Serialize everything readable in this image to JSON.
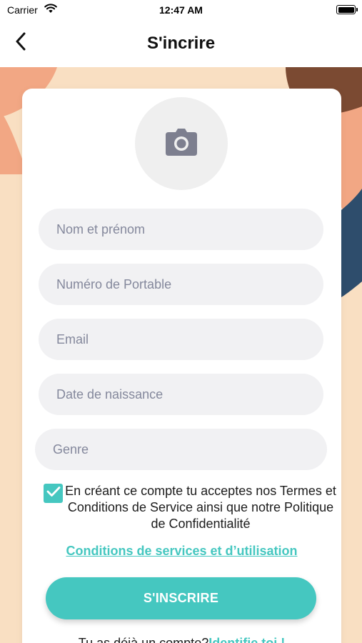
{
  "status_bar": {
    "carrier": "Carrier",
    "time": "12:47 AM",
    "wifi_icon": "wifi-icon",
    "battery_icon": "battery-icon"
  },
  "header": {
    "title": "S'incrire",
    "back_icon": "chevron-left-icon"
  },
  "avatar": {
    "icon": "camera-icon"
  },
  "form": {
    "full_name": {
      "placeholder": "Nom et prénom",
      "value": ""
    },
    "phone": {
      "placeholder": "Numéro de Portable",
      "value": ""
    },
    "email": {
      "placeholder": "Email",
      "value": ""
    },
    "birth_date": {
      "placeholder": "Date de naissance",
      "value": ""
    },
    "gender": {
      "placeholder": "Genre",
      "value": ""
    }
  },
  "consent": {
    "checked": true,
    "text": "En créant ce compte tu acceptes nos Termes et Conditions de Service ainsi que notre Politique de Confidentialité",
    "terms_link": "Conditions de services et d’utilisation"
  },
  "submit_label": "S'INSCRIRE",
  "login": {
    "prompt": "Tu as déjà un compte?",
    "link": "Identifie toi !"
  },
  "colors": {
    "accent": "#45c7c0",
    "background": "#f9dfc2",
    "salmon": "#f2a784",
    "brown": "#7b4a32",
    "navy": "#2e4d6c",
    "field_bg": "#f1f1f3",
    "placeholder": "#84889c",
    "camera_icon": "#7d7f8f"
  }
}
